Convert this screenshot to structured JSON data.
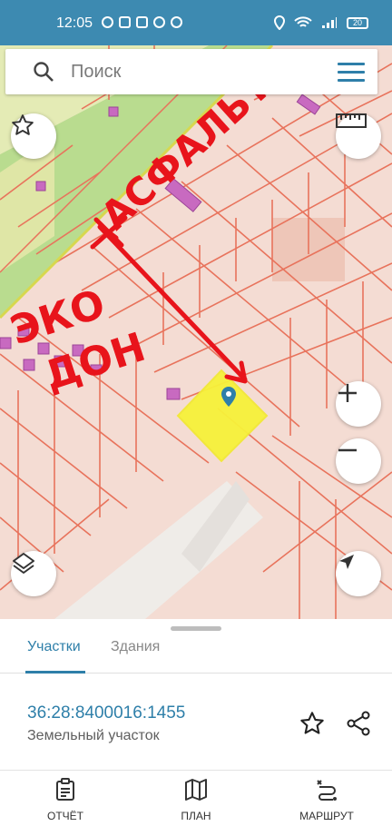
{
  "status_bar": {
    "time": "12:05",
    "battery": "20"
  },
  "search": {
    "placeholder": "Поиск"
  },
  "map_annotations": {
    "road_label": "АСФАЛЬТ",
    "eko_label": "ЭКО",
    "don_label": "ДОН"
  },
  "tabs": [
    {
      "label": "Участки",
      "active": true
    },
    {
      "label": "Здания",
      "active": false
    }
  ],
  "parcel": {
    "cadastral_number": "36:28:8400016:1455",
    "type": "Земельный участок"
  },
  "bottom_nav": [
    {
      "label": "ОТЧЁТ",
      "icon": "clipboard-icon"
    },
    {
      "label": "ПЛАН",
      "icon": "map-icon"
    },
    {
      "label": "МАРШРУТ",
      "icon": "route-icon"
    }
  ],
  "colors": {
    "accent": "#2e7fa9",
    "status_bar": "#3d8ab1",
    "parcel_fill": "#f7f23a",
    "parcel_line": "#e8735c",
    "annotation": "#e8141b"
  }
}
